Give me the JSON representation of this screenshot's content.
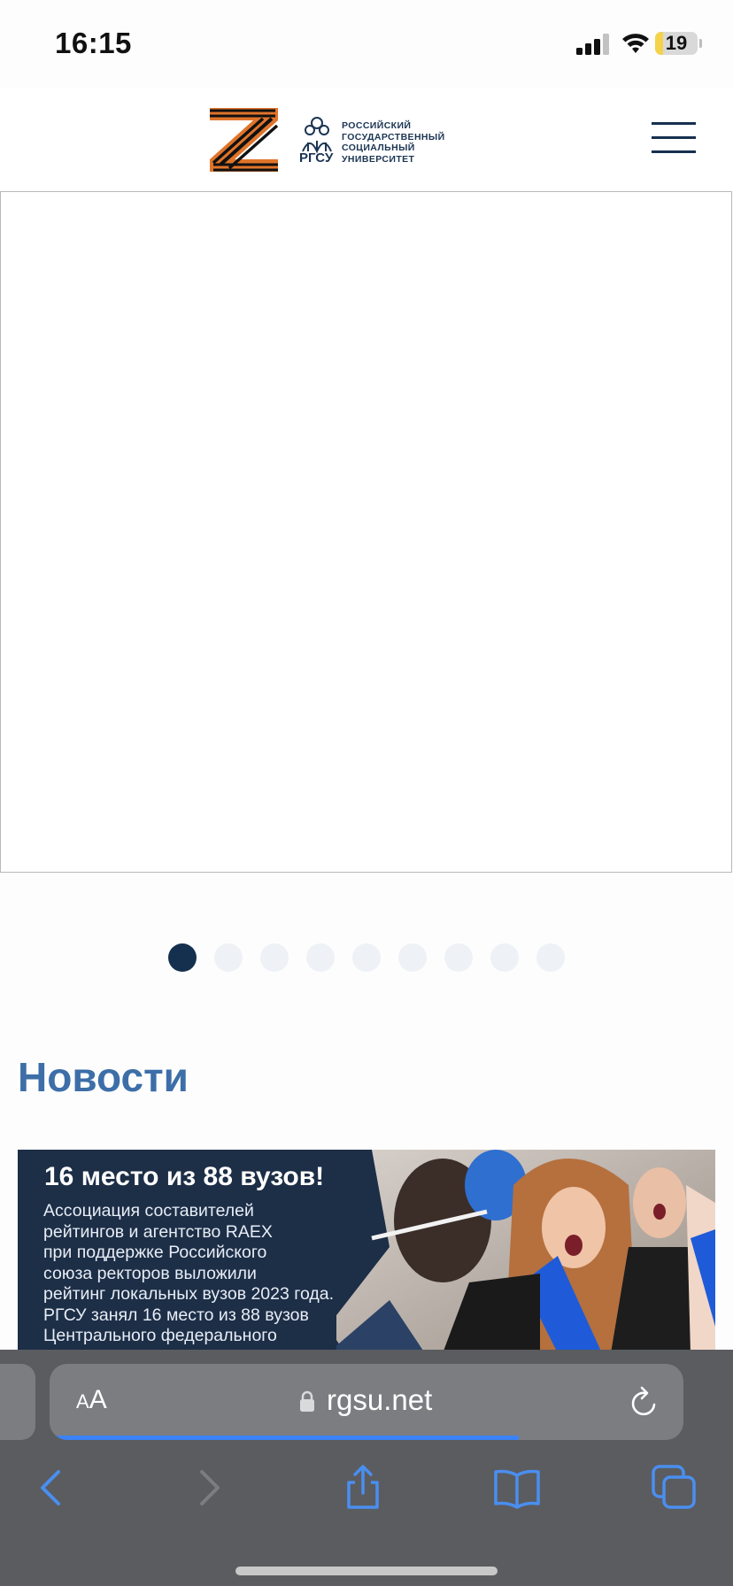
{
  "status_bar": {
    "time": "16:15",
    "battery_level": "19",
    "battery_color": "#f4d34a"
  },
  "header": {
    "logo_abbr": "РГСУ",
    "logo_name_lines": [
      "РОССИЙСКИЙ",
      "ГОСУДАРСТВЕННЫЙ",
      "СОЦИАЛЬНЫЙ",
      "УНИВЕРСИТЕТ"
    ],
    "menu_icon": "hamburger-menu-icon",
    "accent_color": "#16304f"
  },
  "slider": {
    "slide_count": 9,
    "active_index": 0,
    "active_color": "#15304e",
    "inactive_color": "#eef1f5"
  },
  "news": {
    "heading": "Новости",
    "heading_color": "#3d6ea8",
    "first_item": {
      "title": "16 место из 88 вузов!",
      "text_lines": [
        "Ассоциация составителей",
        "рейтингов и агентство RAEX",
        "при поддержке Российского",
        "союза ректоров выложили",
        "рейтинг локальных вузов 2023 года.",
        "РГСУ занял 16 место из 88 вузов",
        "Центрального федерального"
      ]
    }
  },
  "browser": {
    "aa_small": "A",
    "aa_big": "A",
    "url": "rgsu.net",
    "load_progress": 0.74,
    "progress_color": "#3b82f6",
    "toolbar": [
      "back-icon",
      "forward-icon",
      "share-icon",
      "bookmarks-icon",
      "tabs-icon"
    ],
    "tint_color": "#4a8ef0"
  }
}
